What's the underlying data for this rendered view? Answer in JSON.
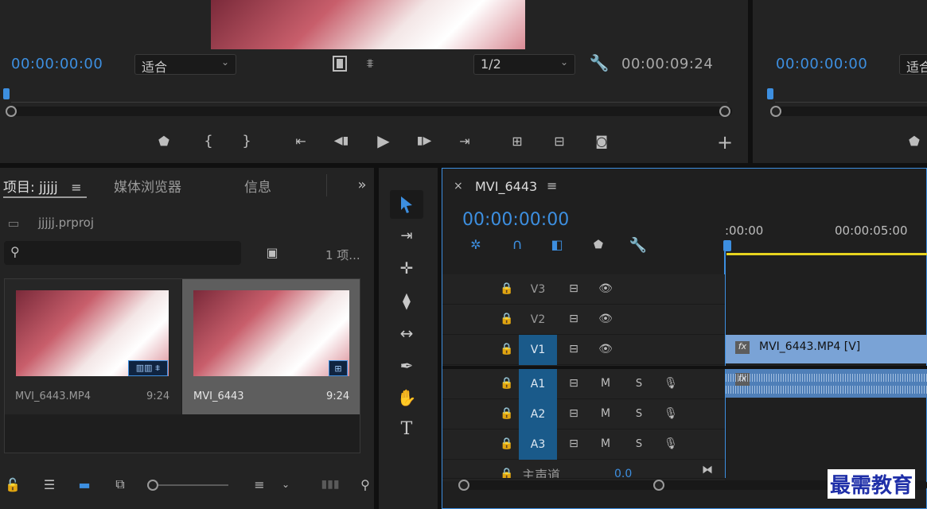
{
  "source_monitor": {
    "timecode_in": "00:00:00:00",
    "fit_select": "适合",
    "resolution_select": "1/2",
    "timecode_duration": "00:00:09:24"
  },
  "program_monitor": {
    "timecode": "00:00:00:00",
    "fit_select_partial": "适合"
  },
  "project_panel": {
    "tabs": [
      "项目: jjjjj",
      "媒体浏览器",
      "信息"
    ],
    "project_file": "jjjjj.prproj",
    "search_placeholder": "",
    "item_count": "1 项...",
    "items": [
      {
        "name": "MVI_6443.MP4",
        "duration": "9:24"
      },
      {
        "name": "MVI_6443",
        "duration": "9:24"
      }
    ]
  },
  "timeline": {
    "sequence_name": "MVI_6443",
    "timecode": "00:00:00:00",
    "ruler_start": ":00:00",
    "ruler_mark": "00:00:05:00",
    "tracks": [
      {
        "name": "V3",
        "type": "video",
        "active": false
      },
      {
        "name": "V2",
        "type": "video",
        "active": false
      },
      {
        "name": "V1",
        "type": "video",
        "active": true
      },
      {
        "name": "A1",
        "type": "audio",
        "active": true
      },
      {
        "name": "A2",
        "type": "audio",
        "active": true
      },
      {
        "name": "A3",
        "type": "audio",
        "active": true
      }
    ],
    "master_label": "主声道",
    "master_value": "0.0",
    "video_clip_label": "MVI_6443.MP4 [V]",
    "fx_label": "fx",
    "mute_label": "M",
    "solo_label": "S"
  },
  "watermark": "最需教育",
  "colors": {
    "accent": "#3d8fe0",
    "clip_video": "#7aa3d6",
    "clip_audio": "#4f7fb8",
    "track_active": "#1a5a8a"
  }
}
